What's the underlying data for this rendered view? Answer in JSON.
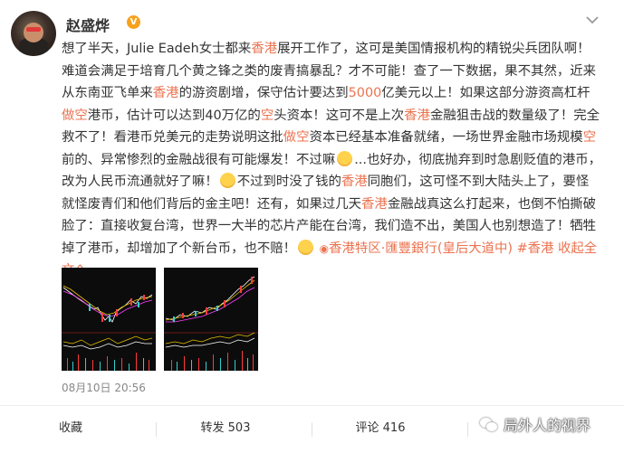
{
  "post": {
    "username": "赵盛烨",
    "verified_badge": "V",
    "more_icon": "chevron-down-icon",
    "content": {
      "l1_a": "想了半天，Julie Eadeh女士都来",
      "l1_hl": "香港",
      "l1_b": "展开工作了，这可是美国情报机构的精锐尖兵团队啊！难",
      "l2": "道会满足于培育几个黄之锋之类的废青搞暴乱？才不可能！查了一下数据，果不其然，近来从东",
      "l3_a": "南亚飞单来",
      "l3_hl1": "香港",
      "l3_b": "的游资剧增，保守估计要达到",
      "l3_hl2": "5000",
      "l3_c": "亿美元以上！如果这部分游资高杠杆",
      "l3_hl3": "做空",
      "l3_d": "港",
      "l4_a": "币，估计可以达到40万亿的",
      "l4_hl1": "空",
      "l4_b": "头资本！这可不是上次",
      "l4_hl2": "香港",
      "l4_c": "金融狙击战的数量级了！完全救不了！",
      "l5_a": "看港币兑美元的走势说明这批",
      "l5_hl": "做空",
      "l5_b": "资本已经基本准备就绪，一场世界金融市场规模",
      "l5_hl2": "空",
      "l5_c": "前的、异常",
      "l6_a": "惨烈的金融战很有可能爆发！不过嘛",
      "l6_b": "...也好办，彻底抛弃到时急剧贬值的港币，改为人民币流",
      "l7": "通就好了嘛！",
      "l7_b": "不过到时没了钱的",
      "l7_hl": "香港",
      "l7_c": "同胞们，这可怪不到大陆头上了，要怪就怪废青们和他",
      "l8": "们背后的金主吧！还有，如果过几天",
      "l8_hl": "香港",
      "l8_b": "金融战真这么打起来，也倒不怕撕破脸了：直接收复台",
      "l9": "湾，世界一大半的芯片产能在台湾，我们造不出，美国人也别想造了！牺牲掉了港币，却增加了",
      "l10": "个新台币，也不赔！",
      "location_icon": "location-pin-icon",
      "location": "香港特区·匯豐銀行(皇后大道中)",
      "hashtag": "#香港",
      "collapse": "收起全文",
      "collapse_icon": "chevron-up-icon"
    },
    "images": [
      {
        "name": "stock-chart-image-1",
        "kind": "stock candlestick chart screenshot"
      },
      {
        "name": "stock-chart-image-2",
        "kind": "stock candlestick chart screenshot"
      }
    ],
    "timestamp": "08月10日 20:56"
  },
  "actions": {
    "favorite": "收藏",
    "repost": "转发 503",
    "comment": "评论 416",
    "like_icon": "thumb-up-icon"
  },
  "watermark": {
    "text": "局外人的视界",
    "icon": "wechat-icon"
  },
  "colors": {
    "accent": "#eb7350",
    "text": "#333333",
    "muted": "#888888",
    "badge": "#f7a11b"
  }
}
